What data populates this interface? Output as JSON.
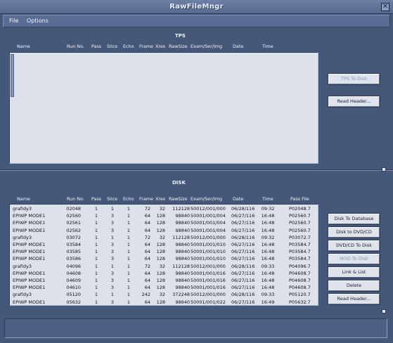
{
  "window": {
    "title": "RawFileMngr",
    "close_glyph": "✕"
  },
  "menu": {
    "file": "File",
    "options": "Options"
  },
  "tps": {
    "title": "TPS",
    "columns": [
      "Name",
      "Run No.",
      "Pass",
      "Slice",
      "Echo",
      "Frame",
      "Xres",
      "RawSize",
      "Exam/Ser/Img",
      "Date",
      "Time"
    ],
    "buttons": {
      "tps_to_disk": "TPS To Disk",
      "read_header": "Read Header..."
    }
  },
  "disk": {
    "title": "DISK",
    "columns": [
      "Name",
      "Run No.",
      "Pass",
      "Slice",
      "Echo",
      "Frame",
      "Xres",
      "RawSize",
      "Exam/Ser/Img",
      "Date",
      "Time",
      "Pass File"
    ],
    "rows": [
      [
        "grafidy3",
        "02048",
        "1",
        "1",
        "1",
        "72",
        "32",
        "112128",
        "50012/001/000",
        "06/28/116",
        "09:32",
        "P02048.7"
      ],
      [
        "EPIWP MODE1",
        "02560",
        "1",
        "3",
        "1",
        "64",
        "128",
        "98840",
        "50001/001/004",
        "06/27/116",
        "16:48",
        "P02560.7"
      ],
      [
        "EPIWP MODE1",
        "02561",
        "1",
        "3",
        "1",
        "64",
        "128",
        "98840",
        "50001/001/004",
        "06/27/116",
        "16:48",
        "P02560.7"
      ],
      [
        "EPIWP MODE1",
        "02562",
        "1",
        "3",
        "1",
        "64",
        "128",
        "98840",
        "50001/001/004",
        "06/27/116",
        "16:48",
        "P02560.7"
      ],
      [
        "grafidy3",
        "03072",
        "1",
        "1",
        "1",
        "72",
        "32",
        "112128",
        "50012/001/000",
        "06/28/116",
        "09:32",
        "P03072.7"
      ],
      [
        "EPIWP MODE1",
        "03584",
        "1",
        "3",
        "1",
        "64",
        "128",
        "98840",
        "50001/001/010",
        "06/27/116",
        "16:48",
        "P03584.7"
      ],
      [
        "EPIWP MODE1",
        "03585",
        "1",
        "3",
        "1",
        "64",
        "128",
        "98840",
        "50001/001/010",
        "06/27/116",
        "16:48",
        "P03584.7"
      ],
      [
        "EPIWP MODE1",
        "03586",
        "1",
        "3",
        "1",
        "64",
        "128",
        "98840",
        "50001/001/010",
        "06/27/116",
        "16:48",
        "P03584.7"
      ],
      [
        "grafidy3",
        "04096",
        "1",
        "1",
        "1",
        "72",
        "32",
        "112128",
        "50012/001/000",
        "06/28/116",
        "09:33",
        "P04096.7"
      ],
      [
        "EPIWP MODE1",
        "04608",
        "1",
        "3",
        "1",
        "64",
        "128",
        "98840",
        "50001/001/016",
        "06/27/116",
        "16:48",
        "P04608.7"
      ],
      [
        "EPIWP MODE1",
        "04609",
        "1",
        "3",
        "1",
        "64",
        "128",
        "98840",
        "50001/001/016",
        "06/27/116",
        "16:48",
        "P04608.7"
      ],
      [
        "EPIWP MODE1",
        "04610",
        "1",
        "3",
        "1",
        "64",
        "128",
        "98840",
        "50001/001/016",
        "06/27/116",
        "16:48",
        "P04608.7"
      ],
      [
        "grafidy3",
        "05120",
        "1",
        "1",
        "1",
        "242",
        "32",
        "372248",
        "50012/001/000",
        "06/28/116",
        "09:33",
        "P05120.7"
      ],
      [
        "EPIWP MODE1",
        "05632",
        "1",
        "3",
        "1",
        "64",
        "128",
        "98840",
        "50001/001/022",
        "06/27/116",
        "16:49",
        "P05632.7"
      ]
    ],
    "buttons": {
      "disk_to_database": "Disk To Database",
      "disk_to_dvd": "Disk to DVD/CD",
      "dvd_to_disk": "DVD/CD To Disk",
      "mod_to_disk": "MOD To Disk",
      "link_list": "Link & List",
      "delete": "Delete",
      "read_header": "Read Header..."
    }
  },
  "status": {
    "message": ""
  }
}
